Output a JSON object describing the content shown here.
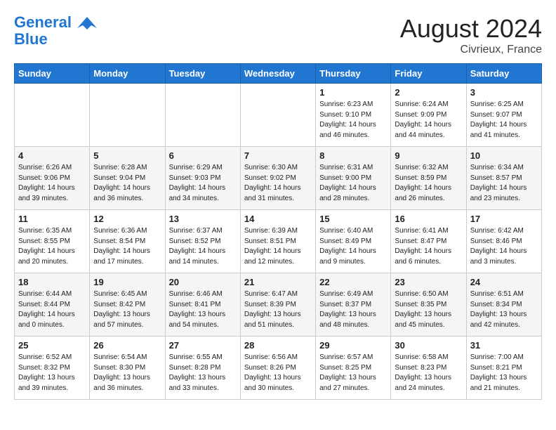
{
  "logo": {
    "line1": "General",
    "line2": "Blue"
  },
  "title": "August 2024",
  "location": "Civrieux, France",
  "days_of_week": [
    "Sunday",
    "Monday",
    "Tuesday",
    "Wednesday",
    "Thursday",
    "Friday",
    "Saturday"
  ],
  "weeks": [
    [
      {
        "day": "",
        "info": ""
      },
      {
        "day": "",
        "info": ""
      },
      {
        "day": "",
        "info": ""
      },
      {
        "day": "",
        "info": ""
      },
      {
        "day": "1",
        "info": "Sunrise: 6:23 AM\nSunset: 9:10 PM\nDaylight: 14 hours\nand 46 minutes."
      },
      {
        "day": "2",
        "info": "Sunrise: 6:24 AM\nSunset: 9:09 PM\nDaylight: 14 hours\nand 44 minutes."
      },
      {
        "day": "3",
        "info": "Sunrise: 6:25 AM\nSunset: 9:07 PM\nDaylight: 14 hours\nand 41 minutes."
      }
    ],
    [
      {
        "day": "4",
        "info": "Sunrise: 6:26 AM\nSunset: 9:06 PM\nDaylight: 14 hours\nand 39 minutes."
      },
      {
        "day": "5",
        "info": "Sunrise: 6:28 AM\nSunset: 9:04 PM\nDaylight: 14 hours\nand 36 minutes."
      },
      {
        "day": "6",
        "info": "Sunrise: 6:29 AM\nSunset: 9:03 PM\nDaylight: 14 hours\nand 34 minutes."
      },
      {
        "day": "7",
        "info": "Sunrise: 6:30 AM\nSunset: 9:02 PM\nDaylight: 14 hours\nand 31 minutes."
      },
      {
        "day": "8",
        "info": "Sunrise: 6:31 AM\nSunset: 9:00 PM\nDaylight: 14 hours\nand 28 minutes."
      },
      {
        "day": "9",
        "info": "Sunrise: 6:32 AM\nSunset: 8:59 PM\nDaylight: 14 hours\nand 26 minutes."
      },
      {
        "day": "10",
        "info": "Sunrise: 6:34 AM\nSunset: 8:57 PM\nDaylight: 14 hours\nand 23 minutes."
      }
    ],
    [
      {
        "day": "11",
        "info": "Sunrise: 6:35 AM\nSunset: 8:55 PM\nDaylight: 14 hours\nand 20 minutes."
      },
      {
        "day": "12",
        "info": "Sunrise: 6:36 AM\nSunset: 8:54 PM\nDaylight: 14 hours\nand 17 minutes."
      },
      {
        "day": "13",
        "info": "Sunrise: 6:37 AM\nSunset: 8:52 PM\nDaylight: 14 hours\nand 14 minutes."
      },
      {
        "day": "14",
        "info": "Sunrise: 6:39 AM\nSunset: 8:51 PM\nDaylight: 14 hours\nand 12 minutes."
      },
      {
        "day": "15",
        "info": "Sunrise: 6:40 AM\nSunset: 8:49 PM\nDaylight: 14 hours\nand 9 minutes."
      },
      {
        "day": "16",
        "info": "Sunrise: 6:41 AM\nSunset: 8:47 PM\nDaylight: 14 hours\nand 6 minutes."
      },
      {
        "day": "17",
        "info": "Sunrise: 6:42 AM\nSunset: 8:46 PM\nDaylight: 14 hours\nand 3 minutes."
      }
    ],
    [
      {
        "day": "18",
        "info": "Sunrise: 6:44 AM\nSunset: 8:44 PM\nDaylight: 14 hours\nand 0 minutes."
      },
      {
        "day": "19",
        "info": "Sunrise: 6:45 AM\nSunset: 8:42 PM\nDaylight: 13 hours\nand 57 minutes."
      },
      {
        "day": "20",
        "info": "Sunrise: 6:46 AM\nSunset: 8:41 PM\nDaylight: 13 hours\nand 54 minutes."
      },
      {
        "day": "21",
        "info": "Sunrise: 6:47 AM\nSunset: 8:39 PM\nDaylight: 13 hours\nand 51 minutes."
      },
      {
        "day": "22",
        "info": "Sunrise: 6:49 AM\nSunset: 8:37 PM\nDaylight: 13 hours\nand 48 minutes."
      },
      {
        "day": "23",
        "info": "Sunrise: 6:50 AM\nSunset: 8:35 PM\nDaylight: 13 hours\nand 45 minutes."
      },
      {
        "day": "24",
        "info": "Sunrise: 6:51 AM\nSunset: 8:34 PM\nDaylight: 13 hours\nand 42 minutes."
      }
    ],
    [
      {
        "day": "25",
        "info": "Sunrise: 6:52 AM\nSunset: 8:32 PM\nDaylight: 13 hours\nand 39 minutes."
      },
      {
        "day": "26",
        "info": "Sunrise: 6:54 AM\nSunset: 8:30 PM\nDaylight: 13 hours\nand 36 minutes."
      },
      {
        "day": "27",
        "info": "Sunrise: 6:55 AM\nSunset: 8:28 PM\nDaylight: 13 hours\nand 33 minutes."
      },
      {
        "day": "28",
        "info": "Sunrise: 6:56 AM\nSunset: 8:26 PM\nDaylight: 13 hours\nand 30 minutes."
      },
      {
        "day": "29",
        "info": "Sunrise: 6:57 AM\nSunset: 8:25 PM\nDaylight: 13 hours\nand 27 minutes."
      },
      {
        "day": "30",
        "info": "Sunrise: 6:58 AM\nSunset: 8:23 PM\nDaylight: 13 hours\nand 24 minutes."
      },
      {
        "day": "31",
        "info": "Sunrise: 7:00 AM\nSunset: 8:21 PM\nDaylight: 13 hours\nand 21 minutes."
      }
    ]
  ]
}
